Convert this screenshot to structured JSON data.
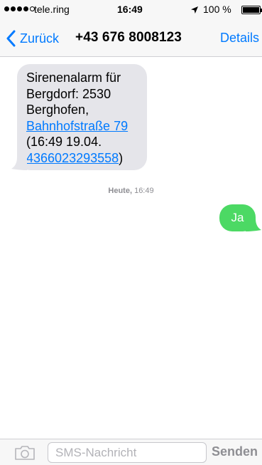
{
  "status_bar": {
    "carrier": "tele.ring",
    "time": "16:49",
    "battery": "100 %",
    "signal_bars_filled": 4,
    "signal_bars_total": 5
  },
  "nav": {
    "back_label": "Zurück",
    "title": "+43 676 8008123",
    "details_label": "Details"
  },
  "messages": {
    "incoming": {
      "line1": "Sirenenalarm für",
      "line2": "Bergdorf: 2530",
      "line3": "Berghofen,",
      "address_link": "Bahnhofstraße 79",
      "line5": "(16:49 19.04.",
      "number_link": "4366023293558",
      "closing_paren": ")"
    },
    "timestamp_day": "Heute,",
    "timestamp_time": " 16:49",
    "outgoing": {
      "text": "Ja"
    }
  },
  "input_bar": {
    "placeholder": "SMS-Nachricht",
    "send_label": "Senden"
  },
  "colors": {
    "accent": "#007aff",
    "incoming_bubble": "#e5e5ea",
    "outgoing_bubble": "#4cd964"
  },
  "icons": [
    "chevron-left-icon",
    "location-arrow-icon",
    "battery-icon",
    "camera-icon"
  ]
}
